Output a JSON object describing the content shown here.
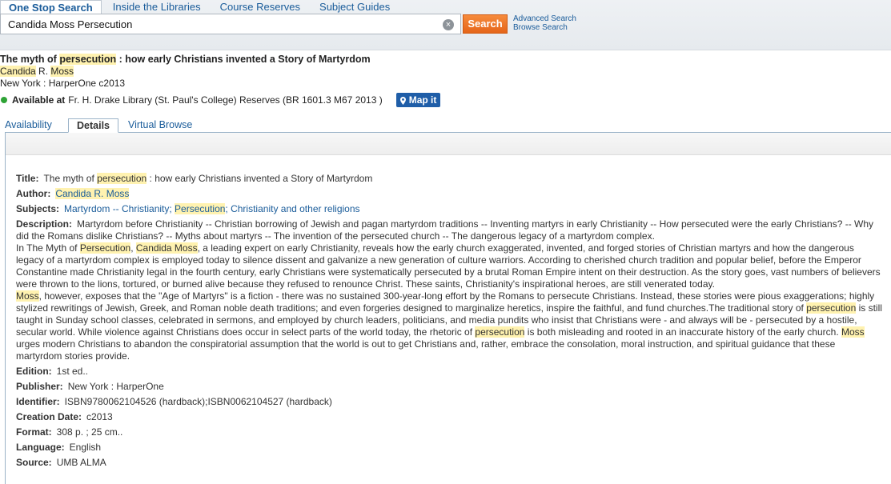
{
  "top_tabs": [
    "One Stop Search",
    "Inside the Libraries",
    "Course Reserves",
    "Subject Guides"
  ],
  "search": {
    "query": "Candida Moss Persecution",
    "clear_icon": "×",
    "button_label": "Search",
    "advanced_label": "Advanced Search",
    "browse_label": "Browse Search"
  },
  "brief": {
    "title_pre": "The myth of ",
    "title_hl": "persecution",
    "title_post": " : how early Christians invented a Story of Martyrdom",
    "author_hl1": "Candida",
    "author_mid": " R. ",
    "author_hl2": "Moss",
    "publisher": "New York : HarperOne c2013",
    "avail_label": "Available at",
    "avail_text": "Fr. H. Drake Library (St. Paul's College) Reserves (BR 1601.3 M67 2013 )",
    "map_label": "Map it",
    "status_color": "#2fa336"
  },
  "detail_tabs": [
    "Availability",
    "Details",
    "Virtual Browse"
  ],
  "details": {
    "title_label": "Title:",
    "title_pre": "The myth of ",
    "title_hl": "persecution",
    "title_post": " : how early Christians invented a Story of Martyrdom",
    "author_label": "Author:",
    "author_value": "Candida R. Moss",
    "subjects_label": "Subjects:",
    "subject_1": "Martyrdom -- Christianity",
    "subject_sep1": "; ",
    "subject_2": "Persecution",
    "subject_sep2": "; ",
    "subject_3": "Christianity and other religions",
    "description_label": "Description:",
    "desc_p1": "Martyrdom before Christianity -- Christian borrowing of Jewish and pagan martyrdom traditions -- Inventing martyrs in early Christianity -- How persecuted were the early Christians? -- Why did the Romans dislike Christians? -- Myths about martyrs -- The invention of the persecuted church -- The dangerous legacy of a martyrdom complex.",
    "desc_p2_a": "In The Myth of ",
    "desc_p2_hl1": "Persecution",
    "desc_p2_b": ", ",
    "desc_p2_hl2": "Candida Moss",
    "desc_p2_c": ", a leading expert on early Christianity, reveals how the early church exaggerated, invented, and forged stories of Christian martyrs and how the dangerous legacy of a martyrdom complex is employed today to silence dissent and galvanize a new generation of culture warriors. According to cherished church tradition and popular belief, before the Emperor Constantine made Christianity legal in the fourth century, early Christians were systematically persecuted by a brutal Roman Empire intent on their destruction. As the story goes, vast numbers of believers were thrown to the lions, tortured, or burned alive because they refused to renounce Christ. These saints, Christianity's inspirational heroes, are still venerated today.",
    "desc_p3_hl1": "Moss",
    "desc_p3_a": ", however, exposes that the \"Age of Martyrs\" is a fiction - there was no sustained 300-year-long effort by the Romans to persecute Christians. Instead, these stories were pious exaggerations; highly stylized rewritings of Jewish, Greek, and Roman noble death traditions; and even forgeries designed to marginalize heretics, inspire the faithful, and fund churches.The traditional story of ",
    "desc_p3_hl2": "persecution",
    "desc_p3_b": " is still taught in Sunday school classes, celebrated in sermons, and employed by church leaders, politicians, and media pundits who insist that Christians were - and always will be - persecuted by a hostile, secular world. While violence against Christians does occur in select parts of the world today, the rhetoric of ",
    "desc_p3_hl3": "persecution",
    "desc_p3_c": " is both misleading and rooted in an inaccurate history of the early church. ",
    "desc_p3_hl4": "Moss",
    "desc_p3_d": " urges modern Christians to abandon the conspiratorial assumption that the world is out to get Christians and, rather, embrace the consolation, moral instruction, and spiritual guidance that these martyrdom stories provide.",
    "edition_label": "Edition:",
    "edition_value": "1st ed..",
    "publisher_label": "Publisher:",
    "publisher_value": "New York : HarperOne",
    "identifier_label": "Identifier:",
    "identifier_value": "ISBN9780062104526 (hardback);ISBN0062104527 (hardback)",
    "creation_label": "Creation Date:",
    "creation_value": "c2013",
    "format_label": "Format:",
    "format_value": "308 p. ; 25 cm..",
    "language_label": "Language:",
    "language_value": "English",
    "source_label": "Source:",
    "source_value": "UMB ALMA"
  }
}
